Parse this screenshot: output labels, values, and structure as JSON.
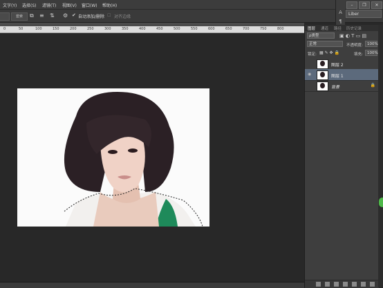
{
  "menu": {
    "items": [
      "文字(Y)",
      "选择(S)",
      "滤镜(T)",
      "视图(V)",
      "窗口(W)",
      "帮助(H)"
    ],
    "window_controls": [
      "–",
      "❐",
      "✕"
    ]
  },
  "options_bar": {
    "left_box_a": "",
    "left_box_b": "套索",
    "auto_add_delete": "自动添加/删除",
    "align_edges": "对齐边缘"
  },
  "language_field": "Liber",
  "ruler_ticks": [
    "0",
    "50",
    "100",
    "150",
    "200",
    "250",
    "300",
    "350",
    "400",
    "450",
    "500",
    "550",
    "600",
    "650",
    "700",
    "750",
    "800"
  ],
  "panel": {
    "tabs": [
      "图层",
      "通道",
      "路径",
      "历史记录"
    ],
    "filter_label": "ρ类型",
    "blend_mode": "正常",
    "opacity_label": "不透明度:",
    "opacity_value": "100%",
    "lock_label": "锁定:",
    "fill_label": "填充:",
    "fill_value": "100%",
    "layers": [
      {
        "name": "图层 2",
        "selected": false
      },
      {
        "name": "图层 1",
        "selected": true
      },
      {
        "name": "背景",
        "selected": false
      }
    ]
  },
  "colors": {
    "selected_layer": "#5c6a7c",
    "accent_green": "#4fb84a"
  }
}
